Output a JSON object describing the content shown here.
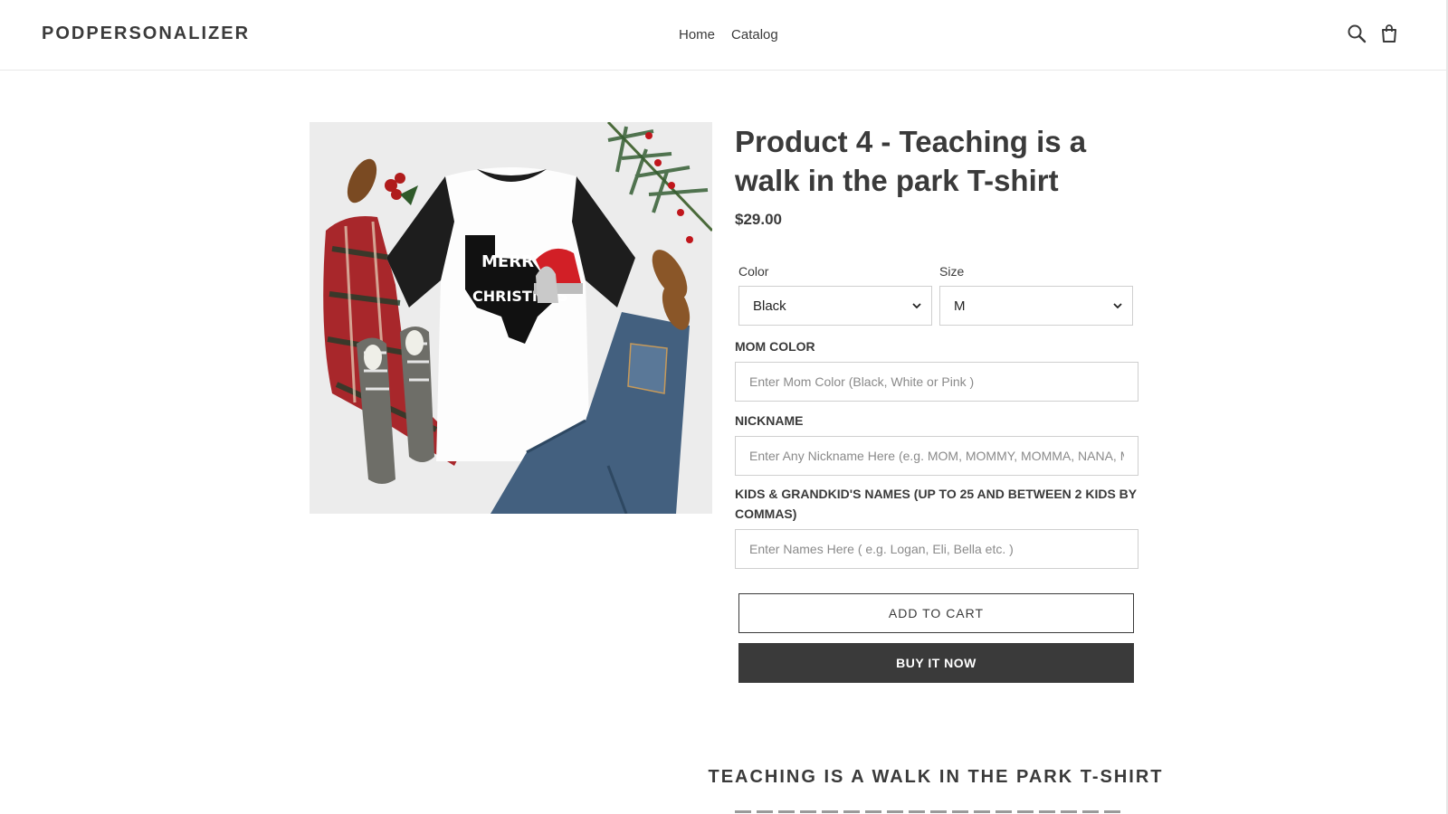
{
  "header": {
    "logo": "PODPERSONALIZER",
    "nav": [
      {
        "label": "Home"
      },
      {
        "label": "Catalog"
      }
    ],
    "icons": [
      "search-icon",
      "cart-icon"
    ]
  },
  "product": {
    "title": "Product 4 - Teaching is a walk in the park T-shirt",
    "price": "$29.00",
    "image": {
      "shirt_text": [
        "MERRY",
        "CHRISTMAS"
      ]
    },
    "options": {
      "color": {
        "label": "Color",
        "value": "Black"
      },
      "size": {
        "label": "Size",
        "value": "M"
      }
    },
    "fields": {
      "mom_color": {
        "label": "MOM COLOR",
        "placeholder": "Enter Mom Color (Black, White or Pink )"
      },
      "nickname": {
        "label": "NICKNAME",
        "placeholder": "Enter Any Nickname Here (e.g. MOM, MOMMY, MOMMA, NANA, MIMI, etc.)"
      },
      "kids_names": {
        "label": "KIDS & GRANDKID'S NAMES (UP TO 25 AND BETWEEN 2 KIDS BY COMMAS)",
        "placeholder": "Enter Names Here ( e.g. Logan, Eli, Bella etc. )"
      }
    },
    "buttons": {
      "add_to_cart": "ADD TO CART",
      "buy_now": "BUY IT NOW"
    },
    "description_heading": "TEACHING IS A WALK IN THE PARK T-SHIRT"
  },
  "colors": {
    "text": "#3a3a3a",
    "button_dark": "#3a3a3a",
    "border": "#cfcfcf"
  }
}
